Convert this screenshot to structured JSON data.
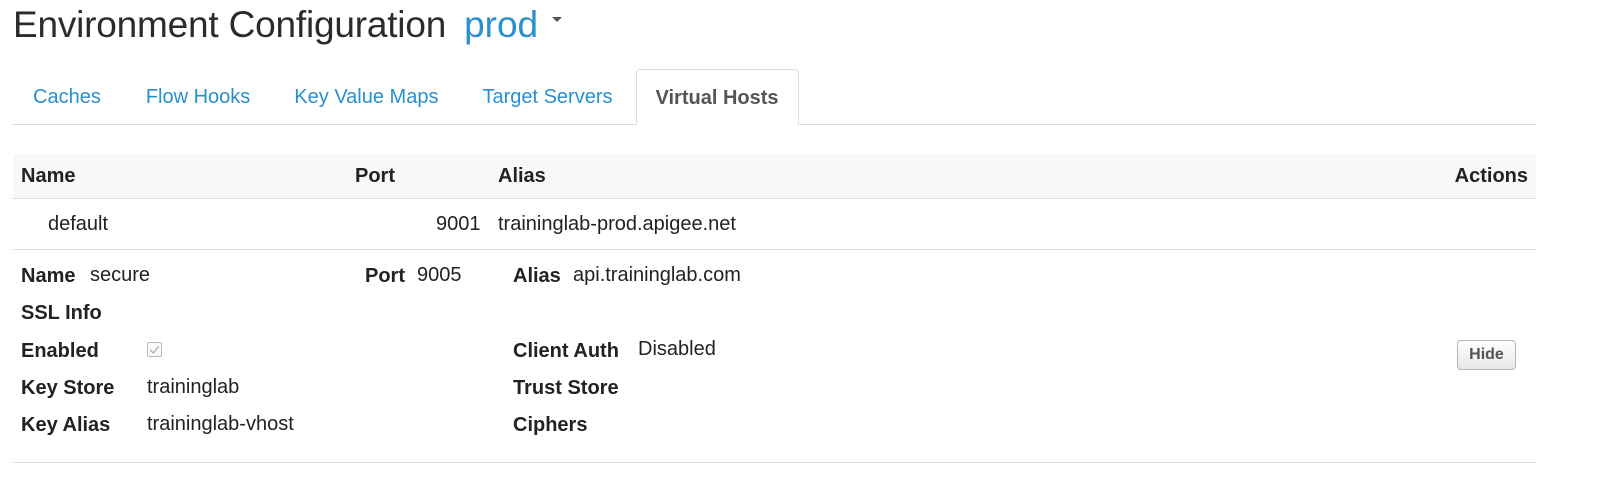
{
  "header": {
    "title": "Environment Configuration",
    "environment": "prod"
  },
  "tabs": [
    {
      "label": "Caches",
      "active": false
    },
    {
      "label": "Flow Hooks",
      "active": false
    },
    {
      "label": "Key Value Maps",
      "active": false
    },
    {
      "label": "Target Servers",
      "active": false
    },
    {
      "label": "Virtual Hosts",
      "active": true
    }
  ],
  "table": {
    "columns": {
      "name": "Name",
      "port": "Port",
      "alias": "Alias",
      "actions": "Actions"
    },
    "rows": [
      {
        "name": "default",
        "port": "9001",
        "alias": "traininglab-prod.apigee.net"
      }
    ],
    "expanded": {
      "name_label": "Name",
      "name_value": "secure",
      "port_label": "Port",
      "port_value": "9005",
      "alias_label": "Alias",
      "alias_value": "api.traininglab.com",
      "ssl_info_label": "SSL Info",
      "enabled_label": "Enabled",
      "enabled_checked": true,
      "client_auth_label": "Client Auth",
      "client_auth_value": "Disabled",
      "key_store_label": "Key Store",
      "key_store_value": "traininglab",
      "trust_store_label": "Trust Store",
      "key_alias_label": "Key Alias",
      "key_alias_value": "traininglab-vhost",
      "ciphers_label": "Ciphers",
      "hide_button": "Hide"
    }
  },
  "colors": {
    "link": "#2a8fcf",
    "header_bg": "#f8f8f8",
    "border": "#dedede"
  }
}
